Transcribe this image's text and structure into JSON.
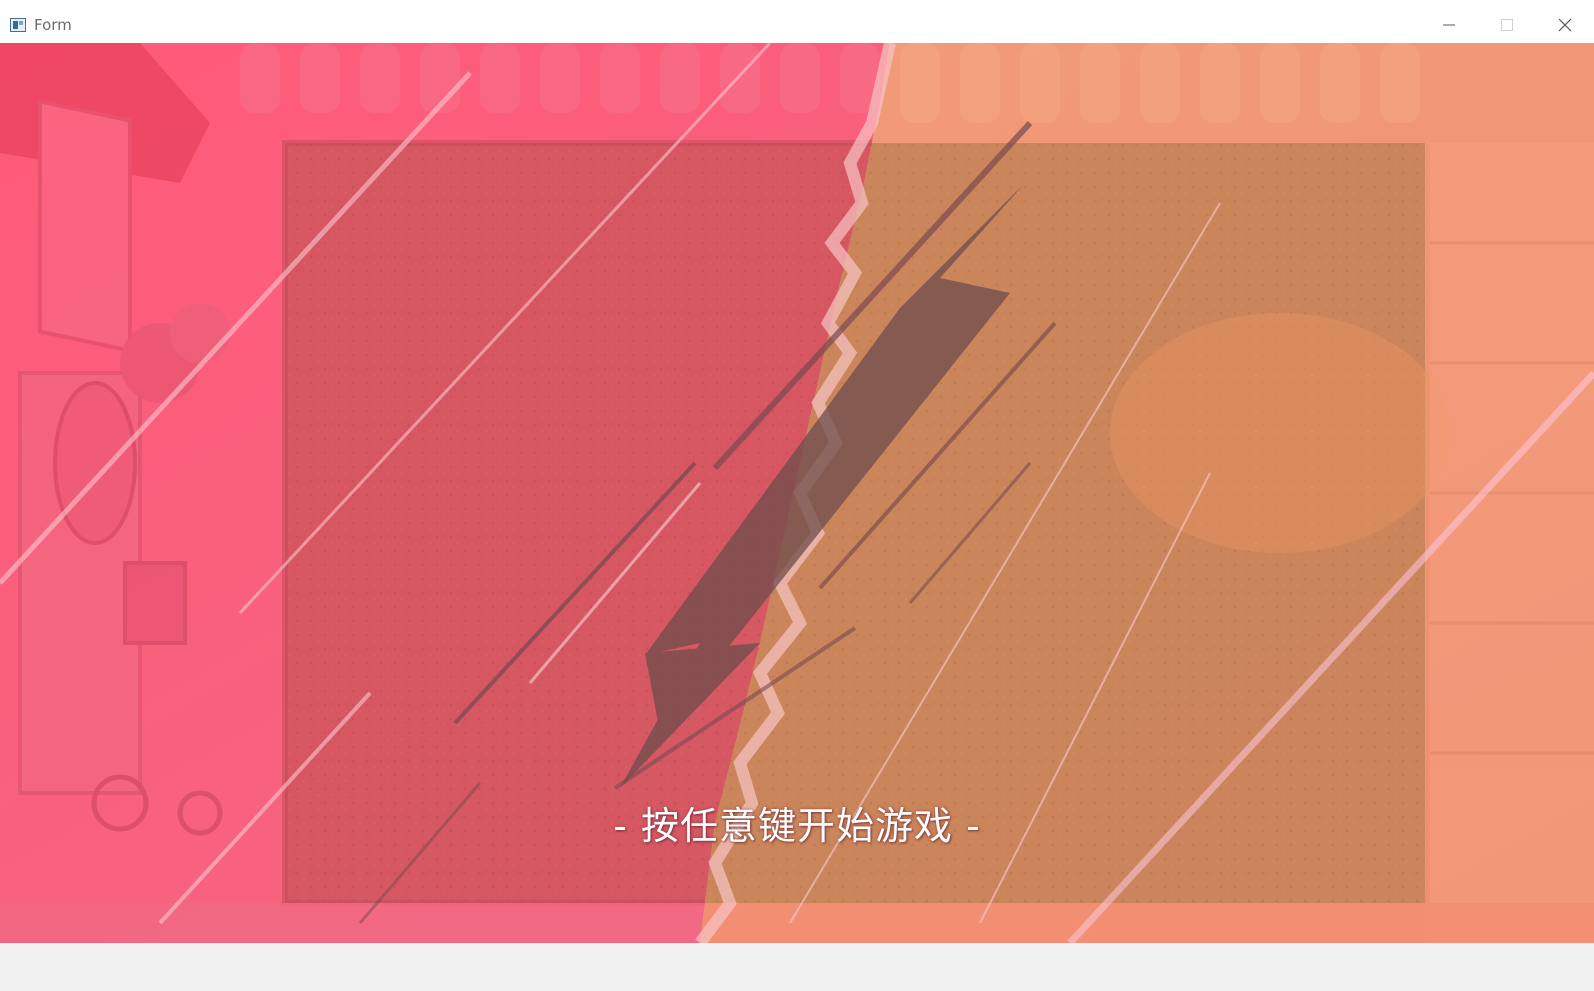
{
  "window": {
    "title": "Form",
    "icon": "window-app-icon",
    "controls": [
      "minimize-icon",
      "maximize-icon",
      "close-icon"
    ]
  },
  "game": {
    "start_prompt": "- 按任意键开始游戏 -"
  },
  "colors": {
    "left_tint": "#f0607a",
    "right_tint": "#ee8a6c",
    "lawn_left": "#d2575f",
    "lawn_right": "#c8845a",
    "bolt": "#7a5a58"
  }
}
